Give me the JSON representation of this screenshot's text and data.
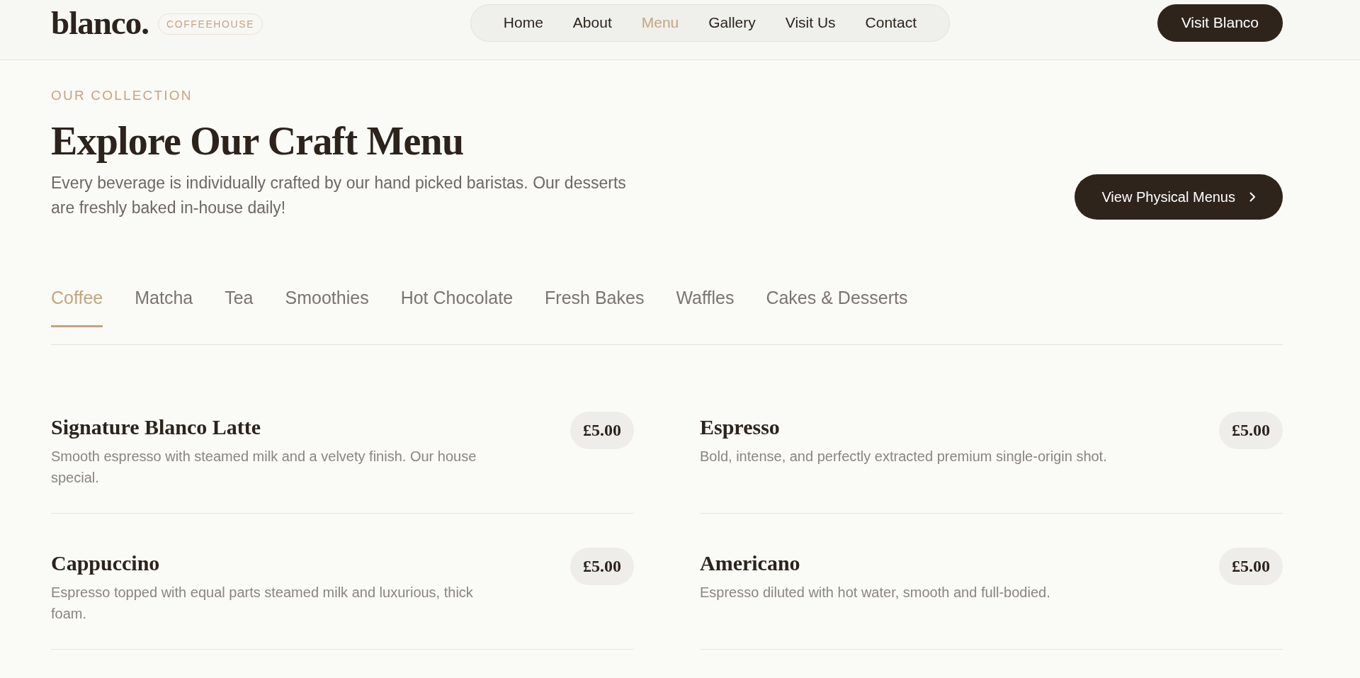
{
  "header": {
    "logo": "blanco.",
    "badge": "COFFEEHOUSE",
    "nav": [
      {
        "label": "Home",
        "selected": false
      },
      {
        "label": "About",
        "selected": false
      },
      {
        "label": "Menu",
        "selected": true
      },
      {
        "label": "Gallery",
        "selected": false
      },
      {
        "label": "Visit Us",
        "selected": false
      },
      {
        "label": "Contact",
        "selected": false
      }
    ],
    "cta": "Visit Blanco"
  },
  "hero": {
    "eyebrow": "OUR COLLECTION",
    "title": "Explore Our Craft Menu",
    "description": "Every beverage is individually crafted by our hand picked baristas. Our desserts are freshly baked in-house daily!",
    "button": "View Physical Menus"
  },
  "categories": [
    {
      "label": "Coffee",
      "selected": true
    },
    {
      "label": "Matcha",
      "selected": false
    },
    {
      "label": "Tea",
      "selected": false
    },
    {
      "label": "Smoothies",
      "selected": false
    },
    {
      "label": "Hot Chocolate",
      "selected": false
    },
    {
      "label": "Fresh Bakes",
      "selected": false
    },
    {
      "label": "Waffles",
      "selected": false
    },
    {
      "label": "Cakes & Desserts",
      "selected": false
    }
  ],
  "items": [
    {
      "name": "Signature Blanco Latte",
      "description": "Smooth espresso with steamed milk and a velvety finish. Our house special.",
      "price": "£5.00"
    },
    {
      "name": "Espresso",
      "description": "Bold, intense, and perfectly extracted premium single-origin shot.",
      "price": "£5.00"
    },
    {
      "name": "Cappuccino",
      "description": "Espresso topped with equal parts steamed milk and luxurious, thick foam.",
      "price": "£5.00"
    },
    {
      "name": "Americano",
      "description": "Espresso diluted with hot water, smooth and full-bodied.",
      "price": "£5.00"
    }
  ]
}
